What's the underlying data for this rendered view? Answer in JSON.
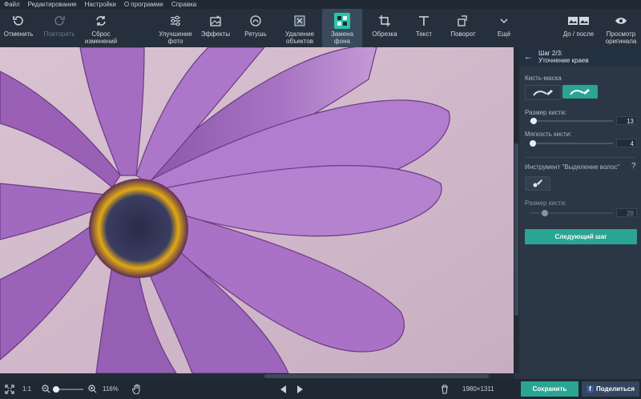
{
  "menu": [
    "Файл",
    "Редактирование",
    "Настройки",
    "О программе",
    "Справка"
  ],
  "toolbar": {
    "undo": "Отменить",
    "redo": "Повторить",
    "reset": "Сброс изменений",
    "enhance": "Улучшение фото",
    "effects": "Эффекты",
    "retouch": "Ретушь",
    "remove_objects": "Удаление объектов",
    "replace_bg": "Замена фона",
    "crop": "Обрезка",
    "text": "Текст",
    "rotate": "Поворот",
    "more": "Ещё",
    "before_after": "До / после",
    "view_original": "Просмотр оригинала"
  },
  "panel": {
    "step_title": "Шаг 2/3:",
    "step_subtitle": "Уточнение краев",
    "brush_mask_label": "Кисть-маска",
    "brush_size_label": "Размер кисти:",
    "brush_size_value": "13",
    "brush_size_level": 0.05,
    "brush_softness_label": "Мягкость кисти:",
    "brush_softness_value": "4",
    "brush_softness_level": 0.02,
    "hair_tool_label": "Инструмент \"Выделение волос\"",
    "help_mark": "?",
    "hair_brush_size_label": "Размер кисти:",
    "hair_brush_size_value": "28",
    "hair_brush_size_level": 0.18,
    "next_step": "Следующий шаг"
  },
  "bottom": {
    "ratio": "1:1",
    "zoom": "116%",
    "zoom_level": 0.1,
    "image_size": "1980×1311",
    "save": "Сохранить",
    "share": "Поделиться",
    "fb_letter": "f"
  },
  "colors": {
    "accent": "#2aa593",
    "active_tab_icon": "#2dc3a8",
    "mask_active": "#2aa593"
  }
}
